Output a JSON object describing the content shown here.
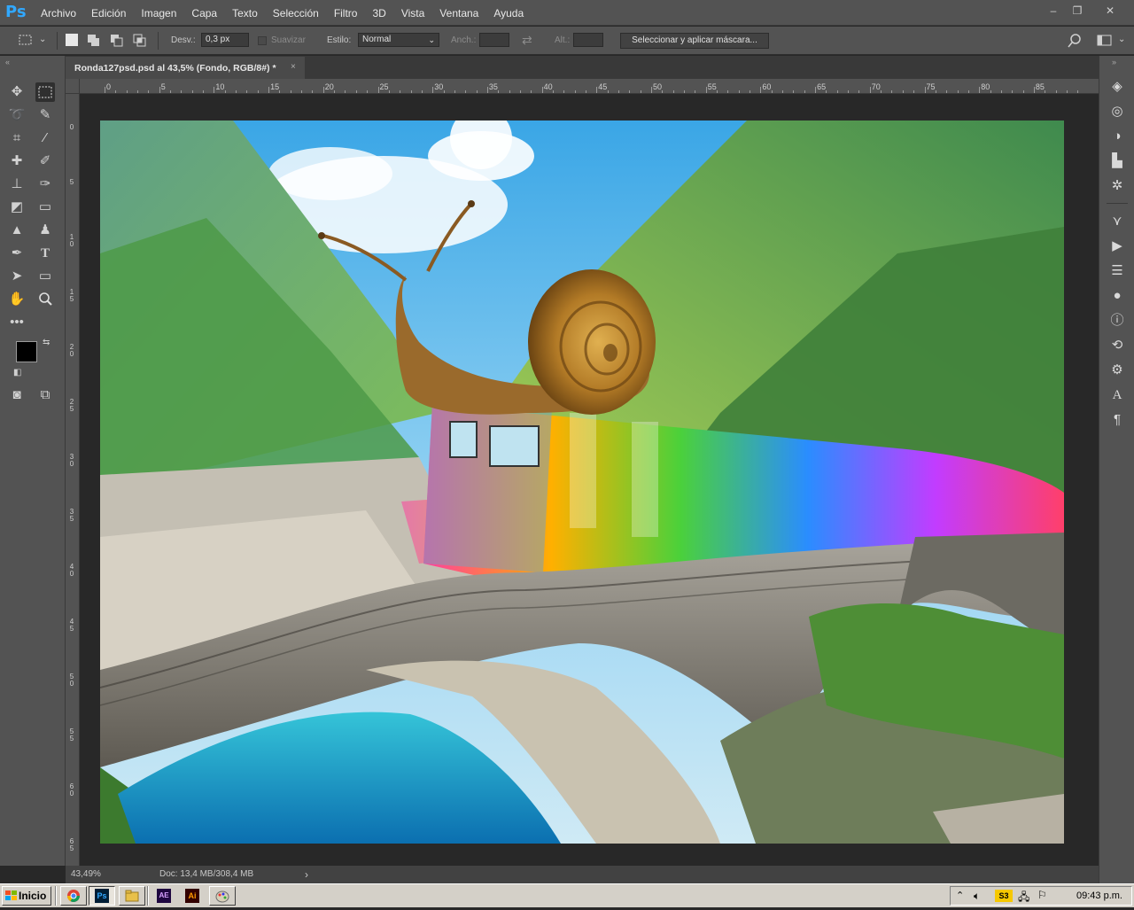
{
  "app": {
    "logo": "Ps"
  },
  "menu": {
    "items": [
      "Archivo",
      "Edición",
      "Imagen",
      "Capa",
      "Texto",
      "Selección",
      "Filtro",
      "3D",
      "Vista",
      "Ventana",
      "Ayuda"
    ]
  },
  "window_controls": {
    "minimize": "–",
    "restore": "❐",
    "close": "✕"
  },
  "options": {
    "feather_label": "Desv.:",
    "feather_value": "0,3 px",
    "antialias_label": "Suavizar",
    "style_label": "Estilo:",
    "style_value": "Normal",
    "width_label": "Anch.:",
    "height_label": "Alt.:",
    "mask_button": "Seleccionar y aplicar máscara..."
  },
  "document": {
    "tab_title": "Ronda127psd.psd al 43,5% (Fondo, RGB/8#)",
    "modified": "*",
    "close": "×"
  },
  "ruler": {
    "top": [
      "0",
      "5",
      "10",
      "15",
      "20",
      "25",
      "30",
      "35",
      "40",
      "45",
      "50",
      "55",
      "60",
      "65",
      "70",
      "75",
      "80",
      "85"
    ],
    "left": [
      "0",
      "5",
      "10",
      "15",
      "20",
      "25",
      "30",
      "35",
      "40",
      "45",
      "50",
      "55",
      "60",
      "65"
    ]
  },
  "status": {
    "zoom": "43,49%",
    "doc": "Doc: 13,4 MB/308,4 MB",
    "arrow": "›"
  },
  "colors": {
    "foreground": "#000000",
    "background": "#0e5e48",
    "accent": "#31a8ff"
  },
  "taskbar": {
    "start": "Inicio",
    "apps": [
      "chrome-icon",
      "photoshop-icon",
      "explorer-icon",
      "after-effects-icon",
      "illustrator-icon",
      "paint-icon"
    ],
    "app_labels": {
      "ps": "Ps",
      "ae": "AE",
      "ai": "Ai"
    },
    "tray_badge": "S3",
    "clock": "09:43 p.m."
  }
}
